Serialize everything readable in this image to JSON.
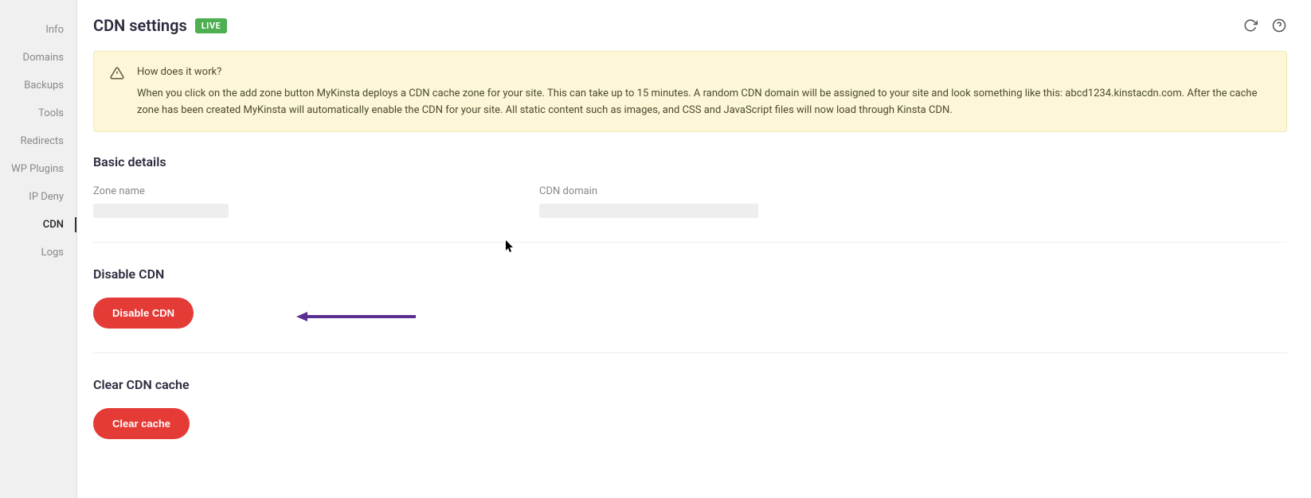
{
  "sidebar": {
    "items": [
      {
        "label": "Info",
        "active": false
      },
      {
        "label": "Domains",
        "active": false
      },
      {
        "label": "Backups",
        "active": false
      },
      {
        "label": "Tools",
        "active": false
      },
      {
        "label": "Redirects",
        "active": false
      },
      {
        "label": "WP Plugins",
        "active": false
      },
      {
        "label": "IP Deny",
        "active": false
      },
      {
        "label": "CDN",
        "active": true
      },
      {
        "label": "Logs",
        "active": false
      }
    ]
  },
  "header": {
    "title": "CDN settings",
    "badge": "LIVE"
  },
  "notice": {
    "title": "How does it work?",
    "body": "When you click on the add zone button MyKinsta deploys a CDN cache zone for your site. This can take up to 15 minutes. A random CDN domain will be assigned to your site and look something like this: abcd1234.kinstacdn.com. After the cache zone has been created MyKinsta will automatically enable the CDN for your site. All static content such as images, and CSS and JavaScript files will now load through Kinsta CDN."
  },
  "basic_details": {
    "title": "Basic details",
    "zone_name_label": "Zone name",
    "cdn_domain_label": "CDN domain"
  },
  "disable_section": {
    "title": "Disable CDN",
    "button": "Disable CDN"
  },
  "clear_section": {
    "title": "Clear CDN cache",
    "button": "Clear cache"
  }
}
